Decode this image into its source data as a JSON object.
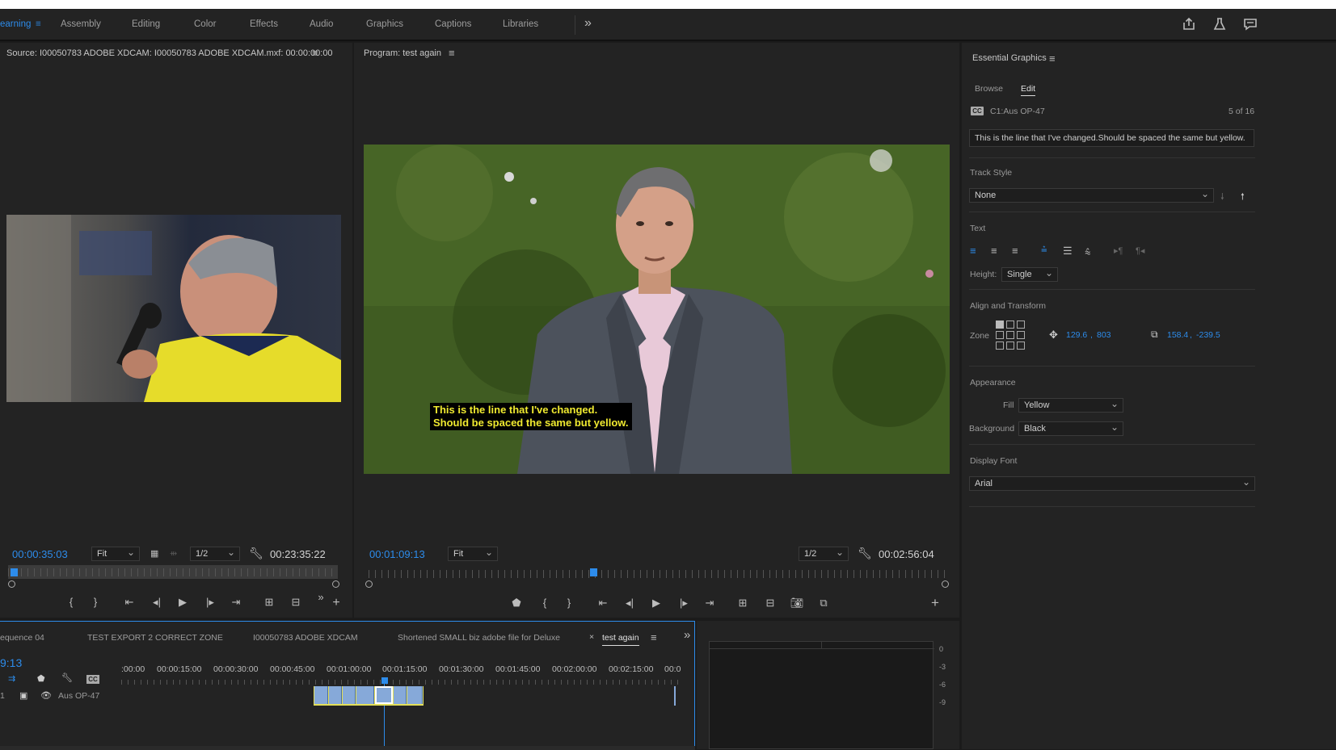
{
  "workspaces": [
    {
      "label": "earning",
      "active": true
    },
    {
      "label": "Assembly"
    },
    {
      "label": "Editing"
    },
    {
      "label": "Color"
    },
    {
      "label": "Effects"
    },
    {
      "label": "Audio"
    },
    {
      "label": "Graphics"
    },
    {
      "label": "Captions"
    },
    {
      "label": "Libraries"
    }
  ],
  "more_glyph": "»",
  "source": {
    "title": "Source: I00050783 ADOBE XDCAM: I00050783 ADOBE XDCAM.mxf: 00:00:00:00",
    "timecode": "00:00:35:03",
    "fit": "Fit",
    "quality": "1/2",
    "duration": "00:23:35:22"
  },
  "program": {
    "title": "Program: test again",
    "timecode": "00:01:09:13",
    "fit": "Fit",
    "quality": "1/2",
    "duration": "00:02:56:04",
    "caption_line1": "This is the line that  I've changed.",
    "caption_line2": "Should be spaced the same but yellow."
  },
  "eg": {
    "title": "Essential Graphics",
    "tab_browse": "Browse",
    "tab_edit": "Edit",
    "clip_name": "C1:Aus OP-47",
    "count": "5 of 16",
    "caption_text": "This is the line that  I've changed.Should be spaced the same but yellow.",
    "track_style_label": "Track Style",
    "track_style_value": "None",
    "text_label": "Text",
    "height_label": "Height:",
    "height_value": "Single",
    "align_label": "Align and Transform",
    "zone_label": "Zone",
    "pos_x": "129.6",
    "pos_y": "803",
    "size_w": "158.4",
    "size_h": "-239.5",
    "appearance_label": "Appearance",
    "fill_label": "Fill",
    "fill_value": "Yellow",
    "background_label": "Background",
    "background_value": "Black",
    "display_font_label": "Display Font",
    "display_font_value": "Arial"
  },
  "timeline": {
    "tabs": [
      "equence 04",
      "TEST EXPORT 2 CORRECT ZONE",
      "I00050783 ADOBE XDCAM",
      "Shortened SMALL biz adobe file for Deluxe",
      "test again"
    ],
    "active_tab": "test again",
    "timecode": "9:13",
    "ruler": [
      ":00:00",
      "00:00:15:00",
      "00:00:30:00",
      "00:00:45:00",
      "00:01:00:00",
      "00:01:15:00",
      "00:01:30:00",
      "00:01:45:00",
      "00:02:00:00",
      "00:02:15:00",
      "00:0"
    ],
    "track_label": "Aus OP-47",
    "track_num": "1"
  },
  "meter": {
    "ticks": [
      "0",
      "-3",
      "-6",
      "-9"
    ]
  }
}
